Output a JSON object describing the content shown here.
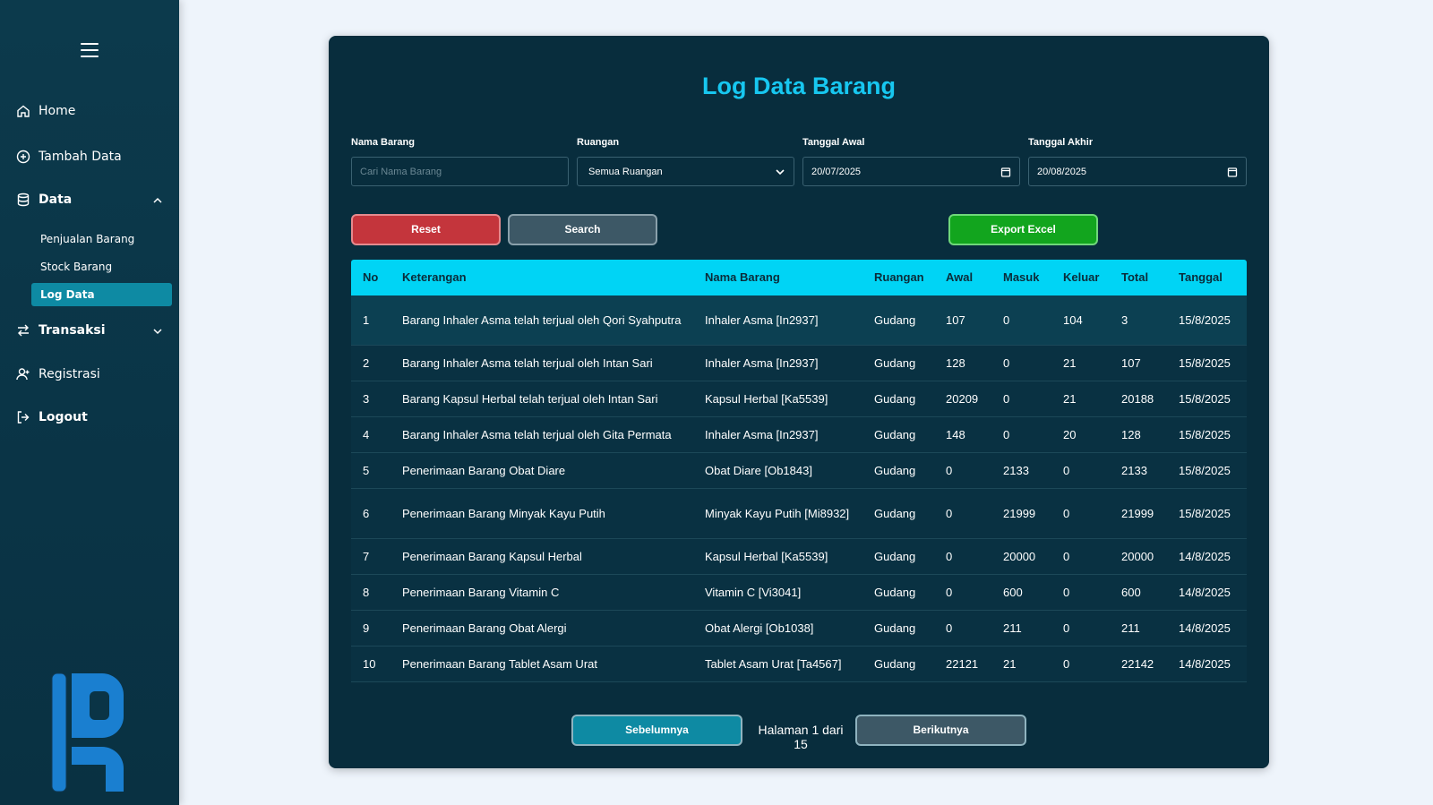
{
  "sidebar": {
    "items": [
      {
        "label": "Home",
        "icon": "home-icon"
      },
      {
        "label": "Tambah Data",
        "icon": "plus-circle-icon"
      },
      {
        "label": "Data",
        "icon": "database-icon"
      },
      {
        "label": "Transaksi",
        "icon": "swap-icon"
      },
      {
        "label": "Registrasi",
        "icon": "user-plus-icon"
      },
      {
        "label": "Logout",
        "icon": "logout-icon"
      }
    ],
    "data_sub": [
      {
        "label": "Penjualan Barang"
      },
      {
        "label": "Stock Barang"
      },
      {
        "label": "Log Data",
        "active": true
      }
    ]
  },
  "page": {
    "title": "Log Data Barang"
  },
  "filters": {
    "nama_label": "Nama Barang",
    "nama_placeholder": "Cari Nama Barang",
    "ruangan_label": "Ruangan",
    "ruangan_value": "Semua Ruangan",
    "tgl_awal_label": "Tanggal Awal",
    "tgl_awal_value": "20/07/2025",
    "tgl_akhir_label": "Tanggal Akhir",
    "tgl_akhir_value": "20/08/2025"
  },
  "actions": {
    "reset": "Reset",
    "search": "Search",
    "export": "Export Excel"
  },
  "table": {
    "headers": [
      "No",
      "Keterangan",
      "Nama Barang",
      "Ruangan",
      "Awal",
      "Masuk",
      "Keluar",
      "Total",
      "Tanggal"
    ],
    "rows": [
      [
        "1",
        "Barang Inhaler Asma telah terjual oleh Qori Syahputra",
        "Inhaler Asma [In2937]",
        "Gudang",
        "107",
        "0",
        "104",
        "3",
        "15/8/2025"
      ],
      [
        "2",
        "Barang Inhaler Asma telah terjual oleh Intan Sari",
        "Inhaler Asma [In2937]",
        "Gudang",
        "128",
        "0",
        "21",
        "107",
        "15/8/2025"
      ],
      [
        "3",
        "Barang Kapsul Herbal telah terjual oleh Intan Sari",
        "Kapsul Herbal [Ka5539]",
        "Gudang",
        "20209",
        "0",
        "21",
        "20188",
        "15/8/2025"
      ],
      [
        "4",
        "Barang Inhaler Asma telah terjual oleh Gita Permata",
        "Inhaler Asma [In2937]",
        "Gudang",
        "148",
        "0",
        "20",
        "128",
        "15/8/2025"
      ],
      [
        "5",
        "Penerimaan Barang Obat Diare",
        "Obat Diare [Ob1843]",
        "Gudang",
        "0",
        "2133",
        "0",
        "2133",
        "15/8/2025"
      ],
      [
        "6",
        "Penerimaan Barang Minyak Kayu Putih",
        "Minyak Kayu Putih [Mi8932]",
        "Gudang",
        "0",
        "21999",
        "0",
        "21999",
        "15/8/2025"
      ],
      [
        "7",
        "Penerimaan Barang Kapsul Herbal",
        "Kapsul Herbal [Ka5539]",
        "Gudang",
        "0",
        "20000",
        "0",
        "20000",
        "14/8/2025"
      ],
      [
        "8",
        "Penerimaan Barang Vitamin C",
        "Vitamin C [Vi3041]",
        "Gudang",
        "0",
        "600",
        "0",
        "600",
        "14/8/2025"
      ],
      [
        "9",
        "Penerimaan Barang Obat Alergi",
        "Obat Alergi [Ob1038]",
        "Gudang",
        "0",
        "211",
        "0",
        "211",
        "14/8/2025"
      ],
      [
        "10",
        "Penerimaan Barang Tablet Asam Urat",
        "Tablet Asam Urat [Ta4567]",
        "Gudang",
        "22121",
        "21",
        "0",
        "22142",
        "14/8/2025"
      ]
    ]
  },
  "pagination": {
    "prev": "Sebelumnya",
    "info": "Halaman 1 dari 15",
    "next": "Berikutnya"
  },
  "colors": {
    "sidebar_bg": "#0a3446",
    "card_bg": "#082d3d",
    "accent": "#00d4f5",
    "title": "#17c7f0",
    "reset": "#c4353c",
    "export": "#12a51e"
  }
}
